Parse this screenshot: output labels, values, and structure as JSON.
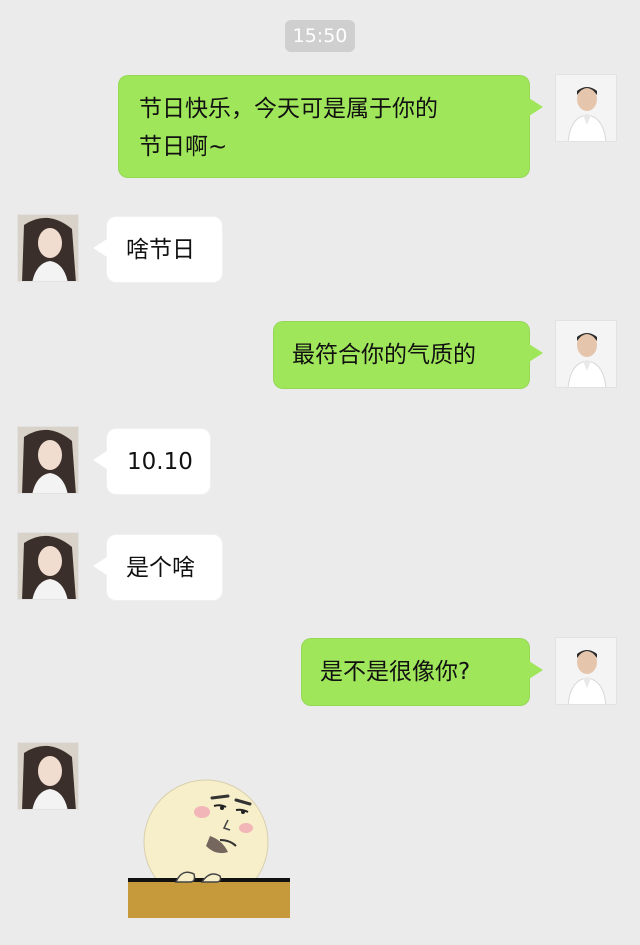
{
  "chat": {
    "timestamp": "15:50",
    "messages": [
      {
        "side": "outgoing",
        "text": "节日快乐，今天可是属于你的\n节日啊~"
      },
      {
        "side": "incoming",
        "text": "啥节日"
      },
      {
        "side": "outgoing",
        "text": "最符合你的气质的"
      },
      {
        "side": "incoming",
        "text": "10.10"
      },
      {
        "side": "incoming",
        "text": "是个啥"
      },
      {
        "side": "outgoing",
        "text": "是不是很像你?"
      },
      {
        "side": "incoming",
        "sticker": "meme-egghead-sticker"
      }
    ]
  },
  "colors": {
    "background": "#ebebeb",
    "outgoing_bubble": "#9fe65a",
    "incoming_bubble": "#ffffff",
    "timestamp_bg": "#cfcfcf"
  },
  "icons": {
    "male_avatar": "male-avatar-icon",
    "female_avatar": "female-avatar-icon",
    "sticker": "meme-sticker-icon"
  }
}
